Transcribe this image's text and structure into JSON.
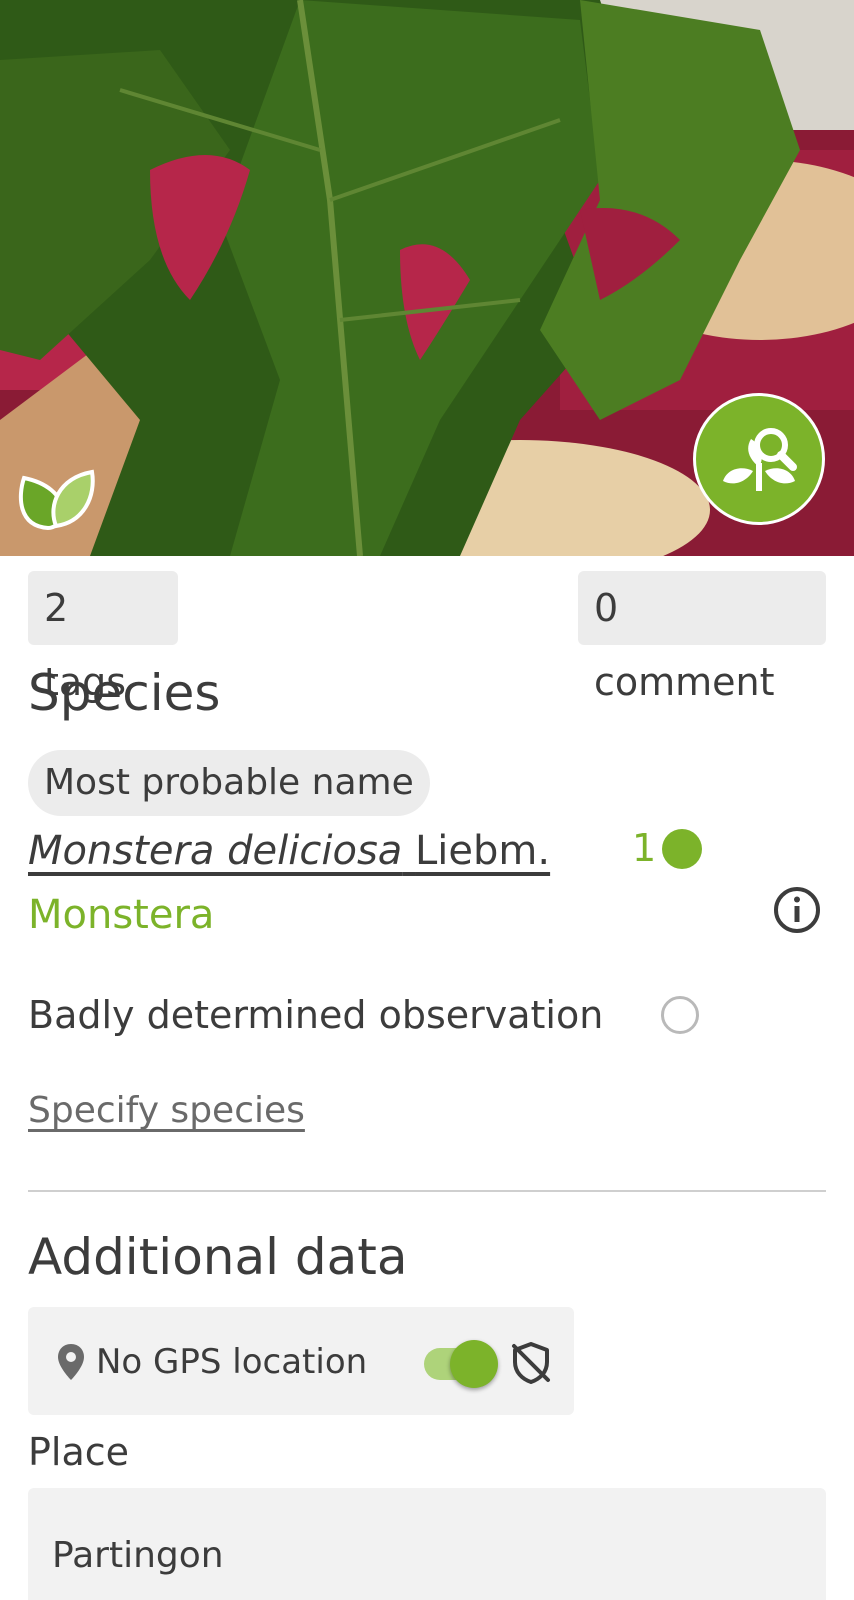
{
  "photo": {
    "subject": "Monstera leaf photo",
    "badge_icon": "leaf-icon",
    "identify_icon": "plant-search-icon"
  },
  "chips": {
    "tags_label": "2 tags",
    "comments_label": "0 comment"
  },
  "species": {
    "heading": "Species",
    "pill_label": "Most probable name",
    "latin_name": "Monstera deliciosa",
    "author": "Liebm.",
    "vote_count": "1",
    "common_name": "Monstera",
    "bad_determination_label": "Badly determined observation",
    "bad_determination_checked": false,
    "specify_link": "Specify species"
  },
  "additional": {
    "heading": "Additional data",
    "gps_label": "No GPS location",
    "gps_toggle_on": true,
    "place_label": "Place",
    "place_value": "Partingon"
  },
  "colors": {
    "accent": "#7cb32a",
    "accent_light": "#aed37a",
    "chip_bg": "#ececec",
    "field_bg": "#f2f2f2",
    "text": "#3c3c3c"
  }
}
